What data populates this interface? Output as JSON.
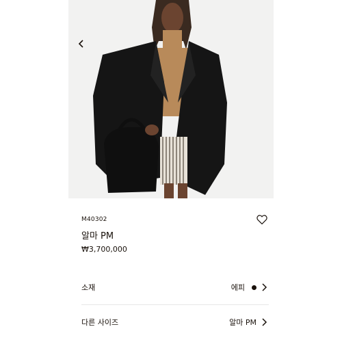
{
  "product": {
    "sku": "M40302",
    "name": "알마 PM",
    "price": "₩3,700,000"
  },
  "details": [
    {
      "label": "소재",
      "value": "에피",
      "has_swatch": true,
      "swatch_color": "#19110b"
    },
    {
      "label": "다른 사이즈",
      "value": "알마 PM",
      "has_swatch": false
    }
  ],
  "icons": {
    "back": "chevron-left-icon",
    "wishlist": "heart-outline-icon",
    "row_arrow": "chevron-right-icon"
  },
  "colors": {
    "text": "#19110b",
    "divider": "#e6e6e6",
    "image_background": "#f2f2f1"
  }
}
